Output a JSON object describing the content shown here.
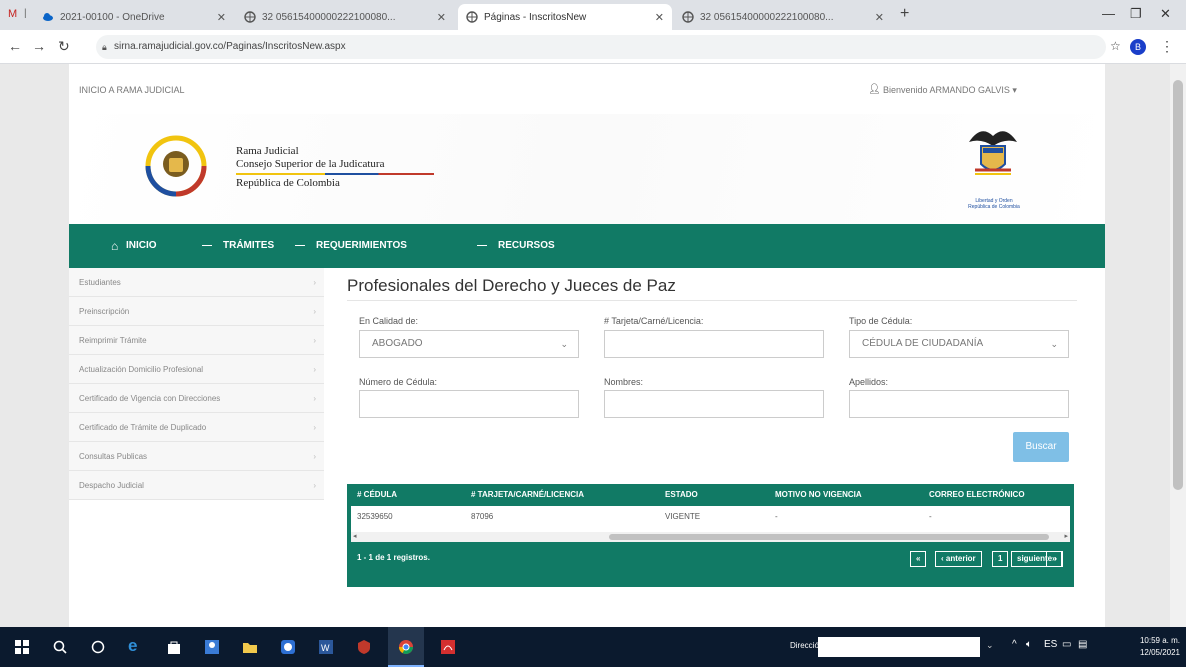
{
  "browser": {
    "tabs": [
      {
        "title": "2021-00100 - OneDrive"
      },
      {
        "title": "32 05615400000222100080..."
      },
      {
        "title": "Páginas - InscritosNew"
      },
      {
        "title": "32 05615400000222100080..."
      }
    ],
    "url": "sirna.ramajudicial.gov.co/Paginas/InscritosNew.aspx",
    "profile_initial": "B"
  },
  "site": {
    "top_link": "INICIO A RAMA JUDICIAL",
    "welcome": "Bienvenido ARMANDO GALVIS",
    "logo": {
      "line1": "Rama Judicial",
      "line2": "Consejo Superior de la Judicatura",
      "line3": "República de Colombia"
    },
    "crest_caption": "Libertad y Orden\nRepública de Colombia",
    "nav": [
      "INICIO",
      "TRÁMITES",
      "REQUERIMIENTOS",
      "RECURSOS"
    ]
  },
  "sidebar": {
    "items": [
      {
        "label": "Estudiantes"
      },
      {
        "label": "Preinscripción"
      },
      {
        "label": "Reimprimir Trámite"
      },
      {
        "label": "Actualización Domicilio Profesional"
      },
      {
        "label": "Certificado de Vigencia con Direcciones"
      },
      {
        "label": "Certificado de Trámite de Duplicado"
      },
      {
        "label": "Consultas Publicas"
      },
      {
        "label": "Despacho Judicial"
      }
    ]
  },
  "form": {
    "title": "Profesionales del Derecho y Jueces de Paz",
    "calidad_label": "En Calidad de:",
    "calidad_value": "ABOGADO",
    "tarjeta_label": "# Tarjeta/Carné/Licencia:",
    "tarjeta_value": "",
    "tipo_label": "Tipo de Cédula:",
    "tipo_value": "CÉDULA DE CIUDADANÍA",
    "numero_label": "Número de Cédula:",
    "numero_value": "",
    "nombres_label": "Nombres:",
    "nombres_value": "",
    "apellidos_label": "Apellidos:",
    "apellidos_value": "",
    "search_label": "Buscar"
  },
  "table": {
    "headers": [
      "# CÉDULA",
      "# TARJETA/CARNÉ/LICENCIA",
      "ESTADO",
      "MOTIVO NO VIGENCIA",
      "CORREO ELECTRÓNICO"
    ],
    "rows": [
      [
        "32539650",
        "87096",
        "VIGENTE",
        "-",
        "-"
      ]
    ],
    "summary": "1 - 1 de 1 registros.",
    "pager": {
      "first": "«",
      "prev": "‹ anterior",
      "page": "1",
      "next": "siguiente ›",
      "last": "»"
    }
  },
  "taskbar": {
    "address_label": "Dirección",
    "time": "10:59 a. m.",
    "date": "12/05/2021"
  },
  "colors": {
    "brand_green": "#117a65",
    "button_blue": "#7fbfe6"
  }
}
